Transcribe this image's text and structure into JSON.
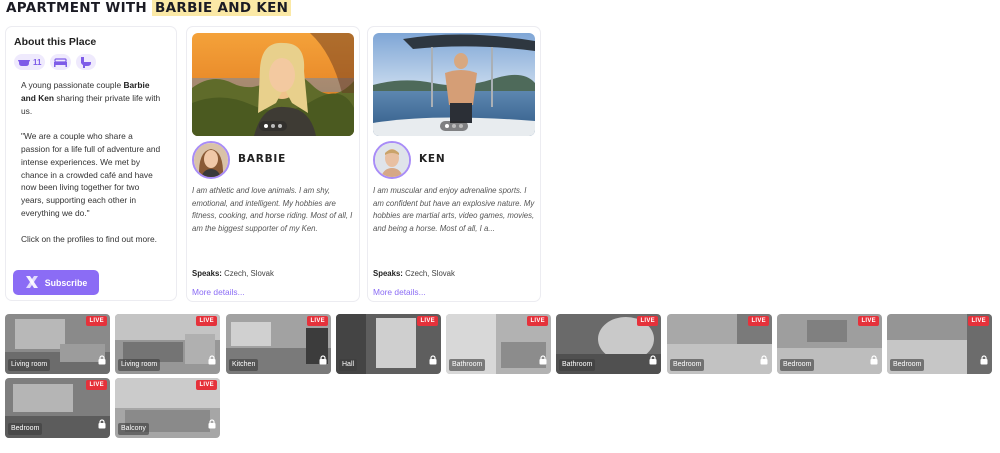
{
  "page": {
    "title_prefix": "APARTMENT WITH",
    "title_highlight": "BARBIE AND KEN"
  },
  "about": {
    "title": "About this Place",
    "amenities": [
      {
        "icon": "bathtub-icon",
        "count": "11"
      },
      {
        "icon": "bed-icon"
      },
      {
        "icon": "toilet-icon"
      }
    ],
    "intro_prefix": "A young passionate couple",
    "intro_name_barbie": "Barbie",
    "intro_and": "and",
    "intro_name_ken": "Ken",
    "intro_suffix": "sharing their private life with us.",
    "quote": "\"We are a couple who share a passion for a life full of adventure and intense experiences. We met by chance in a crowded café and have now been living together for two years, supporting each other in everything we do.\"",
    "cta_text": "Click on the profiles to find out more.",
    "subscribe_label": "Subscribe"
  },
  "profiles": [
    {
      "name": "BARBIE",
      "bio": "I am athletic and love animals. I am shy, emotional, and intelligent. My hobbies are fitness, cooking, and horse riding. Most of all, I am the biggest supporter of my Ken.",
      "speaks_label": "Speaks:",
      "speaks": "Czech, Slovak",
      "more_label": "More details..."
    },
    {
      "name": "KEN",
      "bio": "I am muscular and enjoy adrenaline sports. I am confident but have an explosive nature. My hobbies are martial arts, video games, movies, and being a horse. Most of all, I a...",
      "speaks_label": "Speaks:",
      "speaks": "Czech, Slovak",
      "more_label": "More details..."
    }
  ],
  "rooms": [
    {
      "label": "Living room",
      "badge": "LIVE"
    },
    {
      "label": "Living room",
      "badge": "LIVE"
    },
    {
      "label": "Kitchen",
      "badge": "LIVE"
    },
    {
      "label": "Hall",
      "badge": "LIVE"
    },
    {
      "label": "Bathroom",
      "badge": "LIVE"
    },
    {
      "label": "Bathroom",
      "badge": "LIVE"
    },
    {
      "label": "Bedroom",
      "badge": "LIVE"
    },
    {
      "label": "Bedroom",
      "badge": "LIVE"
    },
    {
      "label": "Bedroom",
      "badge": "LIVE"
    },
    {
      "label": "Bedroom",
      "badge": "LIVE"
    },
    {
      "label": "Balcony",
      "badge": "LIVE"
    }
  ],
  "colors": {
    "accent": "#8b6cf5",
    "highlight": "#fbe9a6",
    "live": "#e5323b"
  }
}
